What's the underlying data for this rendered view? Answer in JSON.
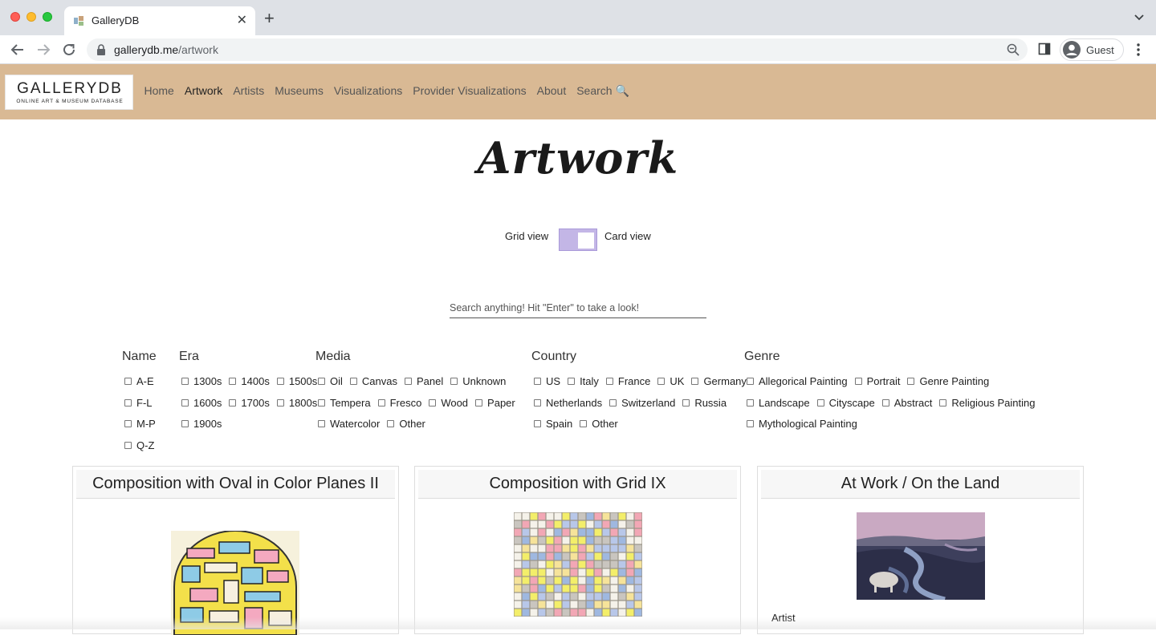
{
  "browser": {
    "tab_title": "GalleryDB",
    "url_domain": "gallerydb.me",
    "url_path": "/artwork",
    "profile_label": "Guest"
  },
  "site": {
    "logo_main": "GALLERYDB",
    "logo_sub": "ONLINE ART & MUSEUM DATABASE",
    "nav": [
      "Home",
      "Artwork",
      "Artists",
      "Museums",
      "Visualizations",
      "Provider Visualizations",
      "About",
      "Search 🔍"
    ],
    "active_nav": "Artwork",
    "nav_bg": "#d9b994"
  },
  "page": {
    "title": "Artwork",
    "grid_label": "Grid view",
    "card_label": "Card view",
    "search_placeholder": "Search anything! Hit \"Enter\" to take a look!"
  },
  "filters": {
    "name": {
      "label": "Name",
      "rows": [
        [
          "A-E"
        ],
        [
          "F-L"
        ],
        [
          "M-P"
        ],
        [
          "Q-Z"
        ]
      ]
    },
    "era": {
      "label": "Era",
      "rows": [
        [
          "1300s",
          "1400s",
          "1500s"
        ],
        [
          "1600s",
          "1700s",
          "1800s"
        ],
        [
          "1900s"
        ]
      ]
    },
    "media": {
      "label": "Media",
      "rows": [
        [
          "Oil",
          "Canvas",
          "Panel",
          "Unknown"
        ],
        [
          "Tempera",
          "Fresco",
          "Wood",
          "Paper"
        ],
        [
          "Watercolor",
          "Other"
        ]
      ]
    },
    "country": {
      "label": "Country",
      "rows": [
        [
          "US",
          "Italy",
          "France",
          "UK",
          "Germany"
        ],
        [
          "Netherlands",
          "Switzerland",
          "Russia"
        ],
        [
          "Spain",
          "Other"
        ]
      ]
    },
    "genre": {
      "label": "Genre",
      "rows": [
        [
          "Allegorical Painting",
          "Portrait",
          "Genre Painting"
        ],
        [
          "Landscape",
          "Cityscape",
          "Abstract",
          "Religious Painting"
        ],
        [
          "Mythological Painting"
        ]
      ]
    }
  },
  "cards": [
    {
      "title": "Composition with Oval in Color Planes II"
    },
    {
      "title": "Composition with Grid IX"
    },
    {
      "title": "At Work / On the Land",
      "field_label": "Artist"
    }
  ]
}
